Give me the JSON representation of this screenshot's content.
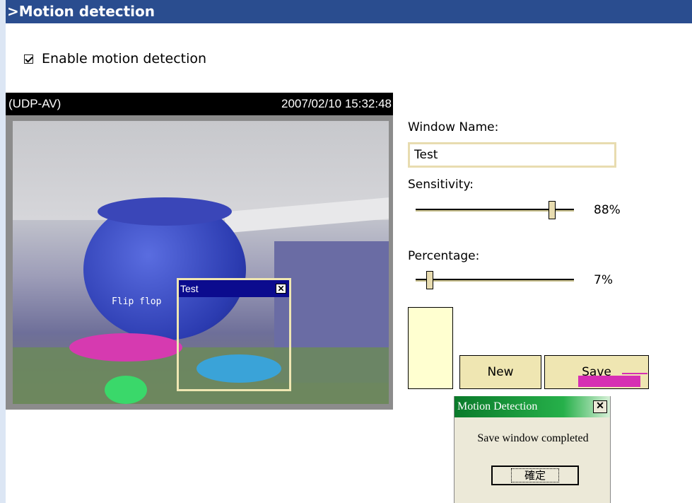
{
  "page": {
    "title": ">Motion detection",
    "enable_label": "Enable motion detection",
    "enable_checked": true
  },
  "video": {
    "stream_label": "(UDP-AV)",
    "timestamp": "2007/02/10 15:32:48",
    "overlay_text": "Flip flop",
    "window": {
      "title": "Test",
      "close_glyph": "✕"
    }
  },
  "panel": {
    "window_name_label": "Window Name:",
    "window_name_value": "Test",
    "sensitivity_label": "Sensitivity:",
    "sensitivity_value": 88,
    "sensitivity_text": "88%",
    "percentage_label": "Percentage:",
    "percentage_value": 7,
    "percentage_text": "7%",
    "new_button": "New",
    "save_button": "Save"
  },
  "dialog": {
    "title": "Motion Detection",
    "close_glyph": "✕",
    "message": "Save window completed",
    "ok_label": "確定"
  },
  "colors": {
    "title_bar": "#2a4d8f",
    "window_title": "#0b0b8e",
    "slider_thumb": "#e8dcb0",
    "dialog_title": "#0a7a2a",
    "preview_fill": "#ffffd0",
    "activity_bar": "#d62fb3"
  }
}
